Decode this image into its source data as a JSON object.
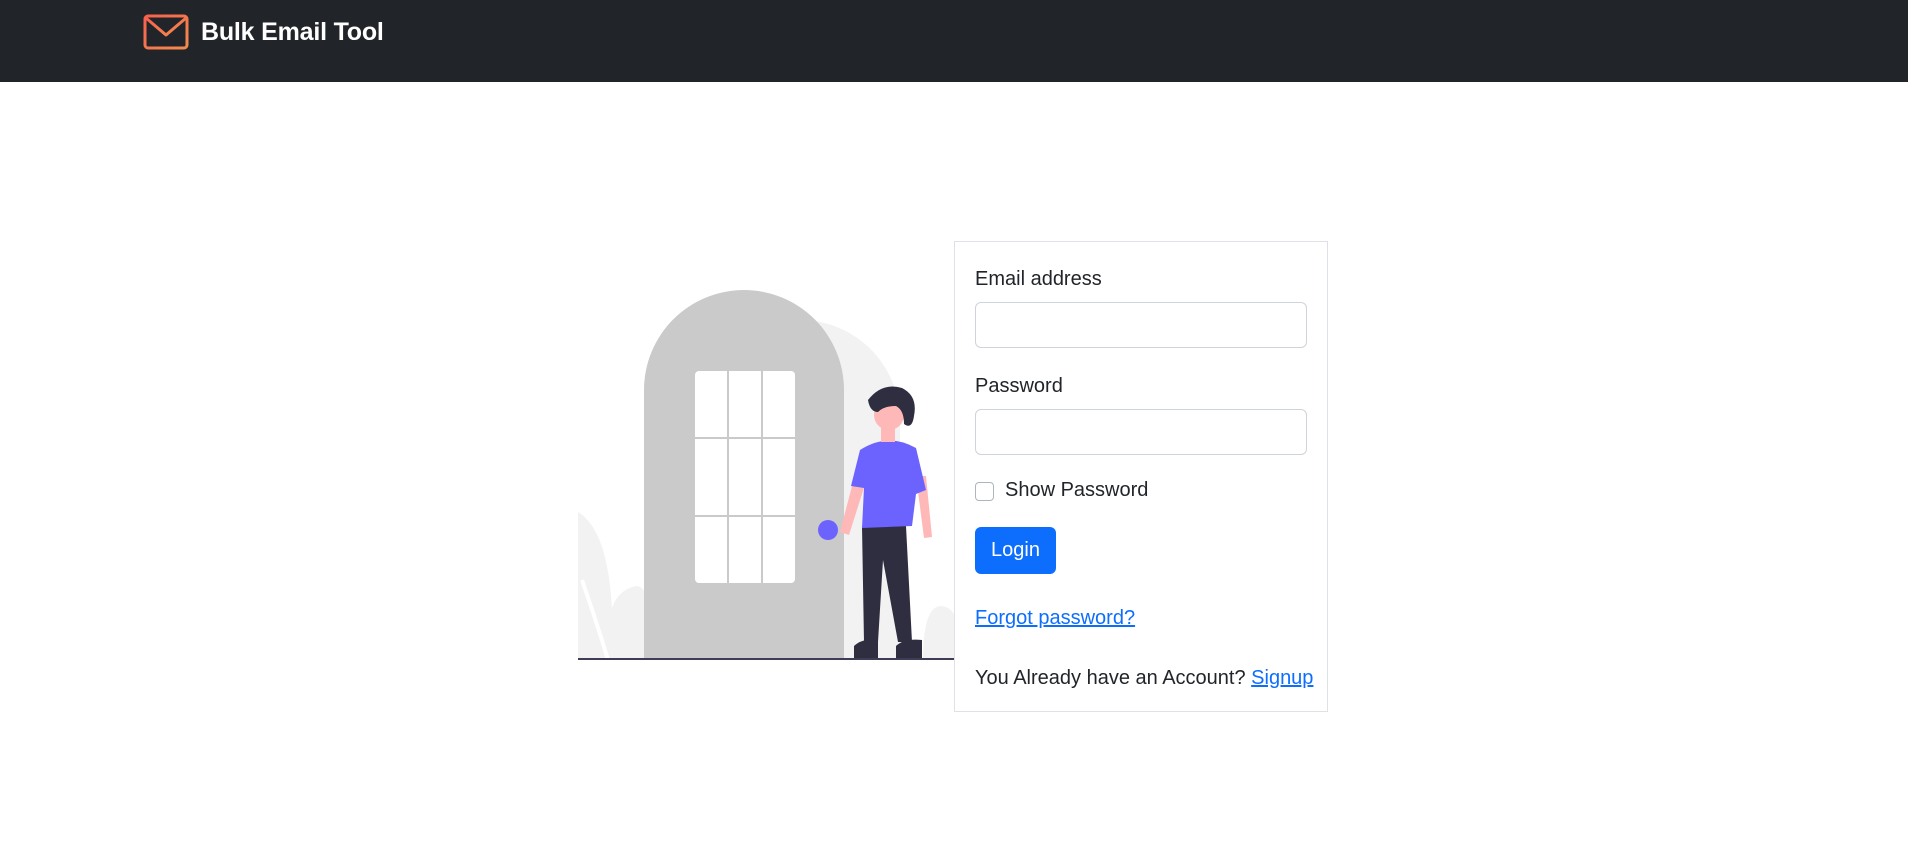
{
  "navbar": {
    "brand_name": "Bulk Email Tool",
    "brand_icon": "envelope-icon",
    "brand_icon_color": "#f7614d",
    "background": "#212529"
  },
  "login": {
    "email_label": "Email address",
    "email_value": "",
    "password_label": "Password",
    "password_value": "",
    "show_password_label": "Show Password",
    "show_password_checked": false,
    "login_button": "Login",
    "forgot_password_link": "Forgot password?",
    "account_prompt": "You Already have an Account?",
    "signup_link": "Signup",
    "accent_color": "#0d6efd"
  },
  "illustration": {
    "icon": "person-at-door-illustration",
    "accent_color": "#6c63ff"
  }
}
